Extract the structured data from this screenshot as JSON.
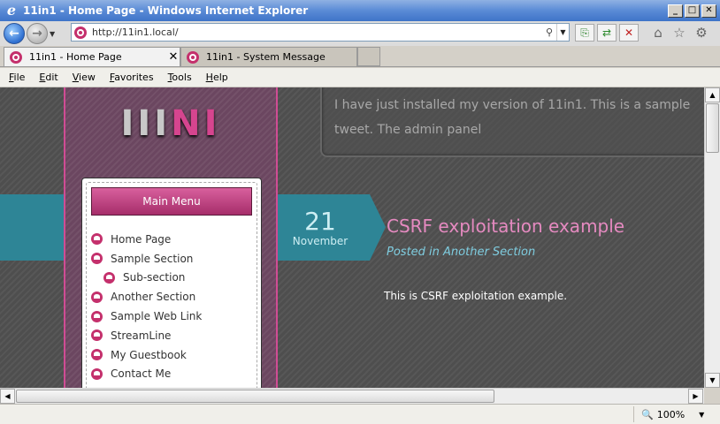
{
  "window": {
    "title": "11in1 - Home Page - Windows Internet Explorer",
    "app_icon": "ie-logo-icon"
  },
  "address_bar": {
    "url": "http://11in1.local/"
  },
  "tabs": [
    {
      "label": "11in1 - Home Page",
      "active": true
    },
    {
      "label": "11in1 - System Message",
      "active": false
    }
  ],
  "menu": [
    "File",
    "Edit",
    "View",
    "Favorites",
    "Tools",
    "Help"
  ],
  "page": {
    "logo_text_a": "III",
    "logo_text_b": "NI",
    "main_menu_label": "Main Menu",
    "menu_items": [
      {
        "label": "Home Page",
        "sub": false
      },
      {
        "label": "Sample Section",
        "sub": false
      },
      {
        "label": "Sub-section",
        "sub": true
      },
      {
        "label": "Another Section",
        "sub": false
      },
      {
        "label": "Sample Web Link",
        "sub": false
      },
      {
        "label": "StreamLine",
        "sub": false
      },
      {
        "label": "My Guestbook",
        "sub": false
      },
      {
        "label": "Contact Me",
        "sub": false
      }
    ],
    "tweet_text": "I have just installed my version of 11in1. This is a sample tweet. The admin panel",
    "post": {
      "day": "21",
      "month": "November",
      "title": "CSRF exploitation example",
      "meta": "Posted in Another Section",
      "body": "This is CSRF exploitation example."
    }
  },
  "status": {
    "zoom": "100%"
  },
  "colors": {
    "accent_pink": "#d04c94",
    "teal": "#2e8596"
  }
}
